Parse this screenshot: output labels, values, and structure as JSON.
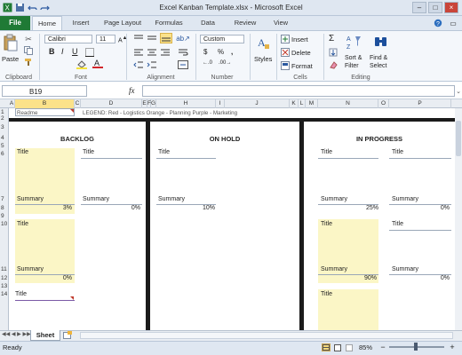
{
  "window": {
    "title": "Excel Kanban Template.xlsx - Microsoft Excel"
  },
  "tabs": [
    "File",
    "Home",
    "Insert",
    "Page Layout",
    "Formulas",
    "Data",
    "Review",
    "View"
  ],
  "ribbon": {
    "paste": "Paste",
    "font_name": "Calibri",
    "font_size": "11",
    "number_format": "Custom",
    "currency": "$",
    "percent": "%",
    "comma": ",",
    "styles": "Styles",
    "insert": "Insert",
    "delete": "Delete",
    "format": "Format",
    "sum": "Σ",
    "sort_filter_1": "Sort &",
    "sort_filter_2": "Filter",
    "find_select_1": "Find &",
    "find_select_2": "Select",
    "groups": {
      "clipboard": "Clipboard",
      "font": "Font",
      "alignment": "Alignment",
      "number": "Number",
      "cells": "Cells",
      "editing": "Editing"
    }
  },
  "formula_bar": {
    "name_box": "B19",
    "fx": "fx"
  },
  "columns": [
    "A",
    "B",
    "C",
    "D",
    "E",
    "F",
    "G",
    "H",
    "I",
    "J",
    "K",
    "L",
    "M",
    "N",
    "O",
    "P"
  ],
  "rows": [
    "1",
    "2",
    "3",
    "4",
    "5",
    "6",
    "7",
    "8",
    "9",
    "10",
    "11",
    "12",
    "13",
    "14"
  ],
  "legend": {
    "readme": "Readme",
    "text": "LEGEND: Red - Logistics     Orange - Planning     Purple - Marketing"
  },
  "board": {
    "backlog": "BACKLOG",
    "on_hold": "ON HOLD",
    "in_progress": "IN PROGRESS",
    "title_label": "Title",
    "summary_label": "Summary",
    "pct_3": "3%",
    "pct_0": "0%",
    "pct_10": "10%",
    "pct_25": "25%",
    "pct_90": "90%"
  },
  "sheet": {
    "tab": "Sheet"
  },
  "status": {
    "ready": "Ready",
    "zoom": "85%"
  },
  "colors": {
    "file_green": "#1f7a35",
    "card_yellow": "#fbf6c6",
    "divider": "#1b1b1b"
  }
}
